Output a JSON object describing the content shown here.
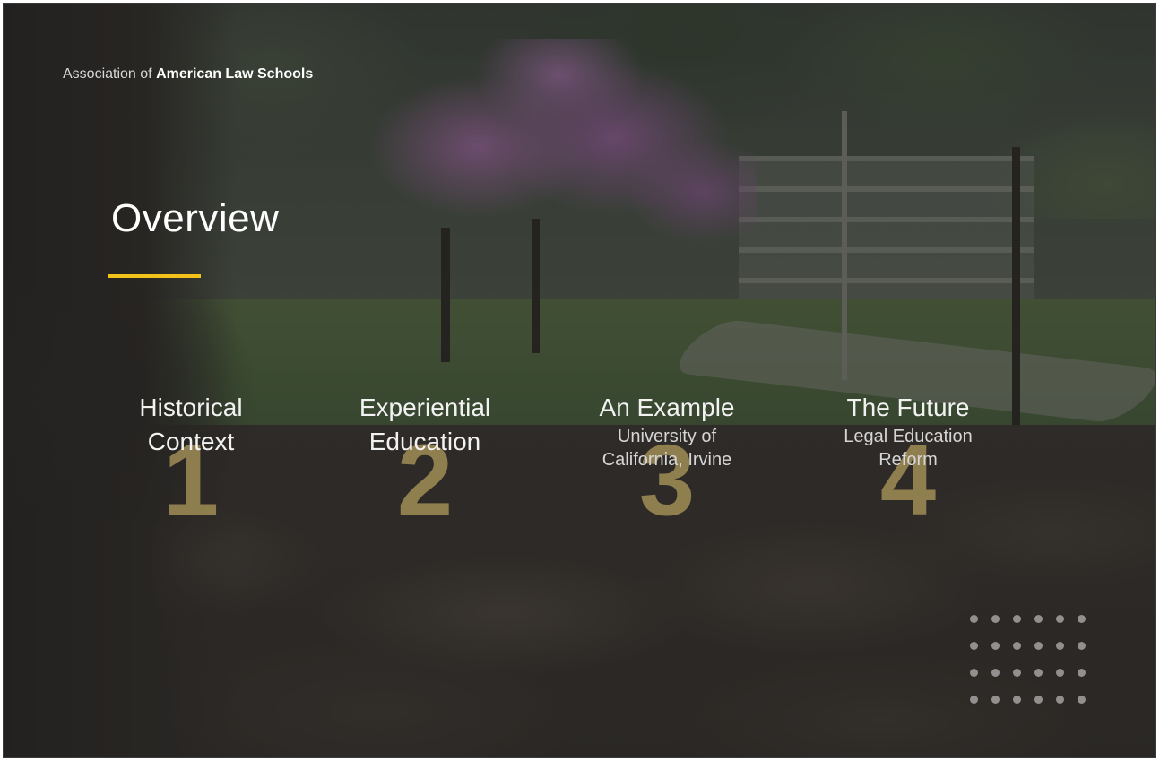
{
  "header": {
    "org_prefix": "Association of",
    "org_name": "American Law Schools"
  },
  "slide": {
    "title": "Overview",
    "accent_color": "#f2c21b"
  },
  "items": [
    {
      "number": "1",
      "title_line1": "Historical",
      "title_line2": "Context",
      "sub_line1": "",
      "sub_line2": ""
    },
    {
      "number": "2",
      "title_line1": "Experiential",
      "title_line2": "Education",
      "sub_line1": "",
      "sub_line2": ""
    },
    {
      "number": "3",
      "title_line1": "An Example",
      "title_line2": "",
      "sub_line1": "University of",
      "sub_line2": "California, Irvine"
    },
    {
      "number": "4",
      "title_line1": "The Future",
      "title_line2": "",
      "sub_line1": "Legal Education",
      "sub_line2": "Reform"
    }
  ],
  "decor": {
    "dot_grid_icon": "dot-grid-icon"
  }
}
